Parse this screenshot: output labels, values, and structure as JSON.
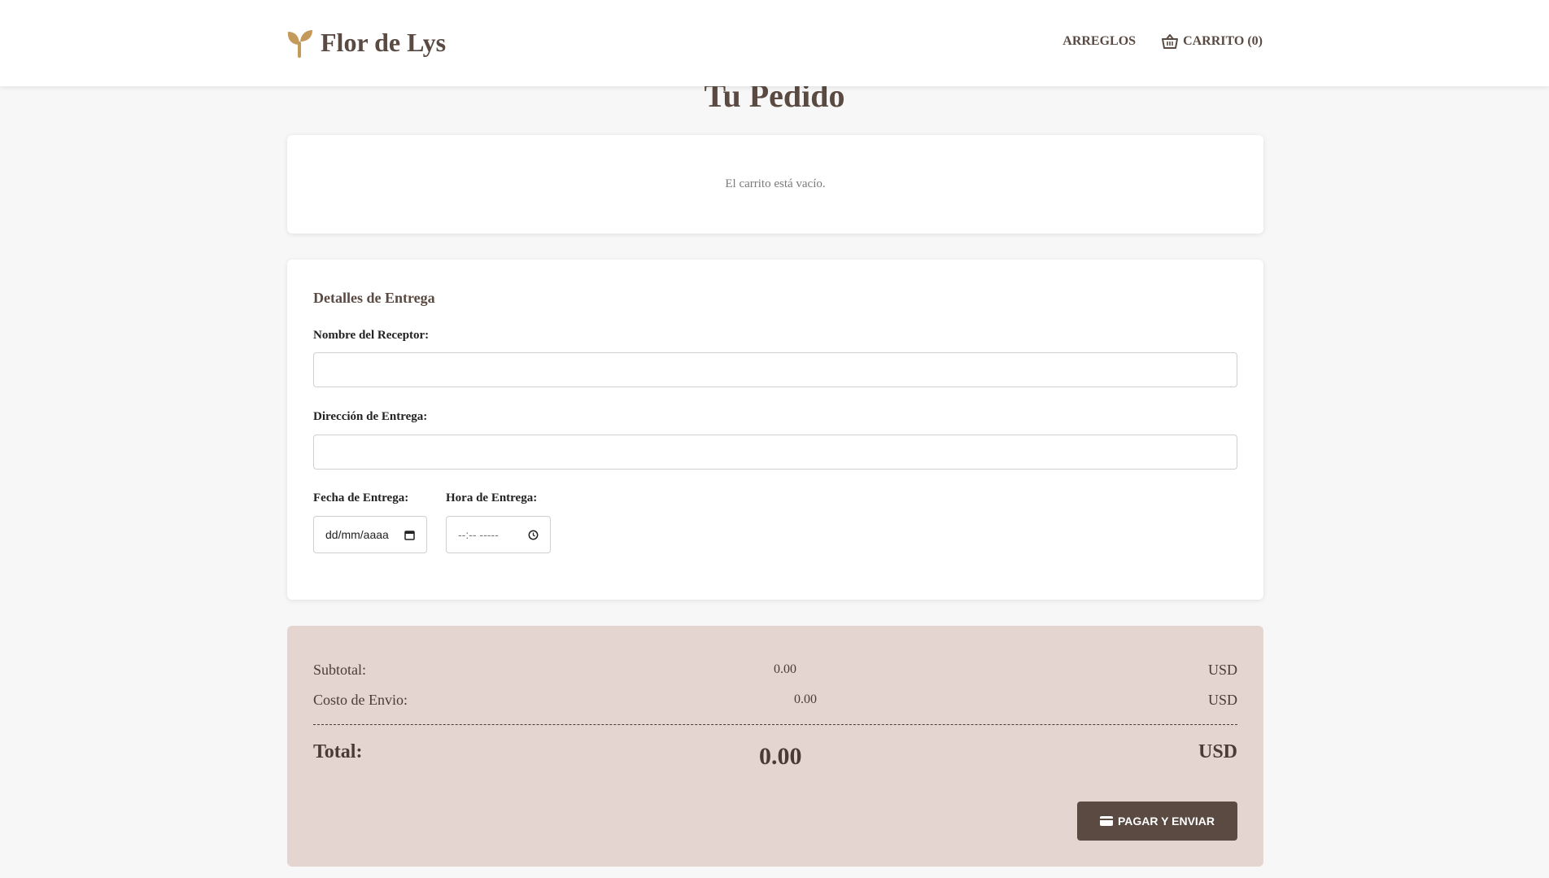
{
  "header": {
    "brand_name": "Flor de Lys",
    "nav": {
      "arrangements": "ARREGLOS",
      "cart": "CARRITO (0)"
    }
  },
  "page": {
    "title": "Tu Pedido"
  },
  "cart": {
    "empty_message": "El carrito está vacío."
  },
  "delivery": {
    "section_title": "Detalles de Entrega",
    "receiver_label": "Nombre del Receptor:",
    "receiver_value": "",
    "address_label": "Dirección de Entrega:",
    "address_value": "",
    "date_label": "Fecha de Entrega:",
    "date_placeholder": "dd/mm/aaaa",
    "time_label": "Hora de Entrega:",
    "time_placeholder": "--:-- -----"
  },
  "summary": {
    "subtotal_label": "Subtotal:",
    "subtotal_value": "0.00",
    "subtotal_unit": "USD",
    "shipping_label": "Costo de Envio:",
    "shipping_value": "0.00",
    "shipping_unit": "USD",
    "total_label": "Total:",
    "total_value": "0.00",
    "total_unit": "USD",
    "pay_button": "PAGAR Y ENVIAR"
  },
  "colors": {
    "brand_accent": "#c49a5a",
    "text_primary": "#5a4a42",
    "summary_bg": "#e4d5d1",
    "button_bg": "#5a4a42"
  },
  "icons": {
    "brand": "sprout-icon",
    "cart": "basket-icon",
    "pay": "credit-card-icon",
    "date": "calendar-icon",
    "time": "clock-icon"
  }
}
